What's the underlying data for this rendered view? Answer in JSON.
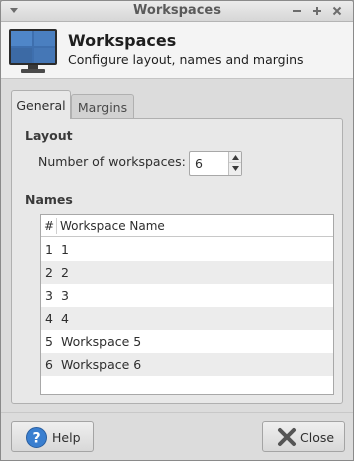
{
  "window": {
    "title": "Workspaces",
    "controls": [
      "minimize-icon",
      "maximize-icon",
      "close-icon"
    ]
  },
  "header": {
    "title": "Workspaces",
    "subtitle": "Configure layout, names and margins",
    "icon": "monitor-icon"
  },
  "tabs": [
    {
      "label": "General",
      "active": true
    },
    {
      "label": "Margins",
      "active": false
    }
  ],
  "layout": {
    "section_label": "Layout",
    "num_workspaces_label": "Number of workspaces:",
    "num_workspaces_value": "6"
  },
  "names": {
    "section_label": "Names",
    "columns": [
      "#",
      "Workspace Name"
    ],
    "rows": [
      {
        "num": "1",
        "name": "1"
      },
      {
        "num": "2",
        "name": "2"
      },
      {
        "num": "3",
        "name": "3"
      },
      {
        "num": "4",
        "name": "4"
      },
      {
        "num": "5",
        "name": "Workspace 5"
      },
      {
        "num": "6",
        "name": "Workspace 6"
      }
    ]
  },
  "buttons": {
    "help_label": "Help",
    "close_label": "Close"
  },
  "colors": {
    "window_bg": "#dcdcdc",
    "header_bg": "#f4f4f4",
    "row_alt": "#ececec",
    "help_icon_blue": "#3a7fd0",
    "close_icon_gray": "#555555"
  }
}
